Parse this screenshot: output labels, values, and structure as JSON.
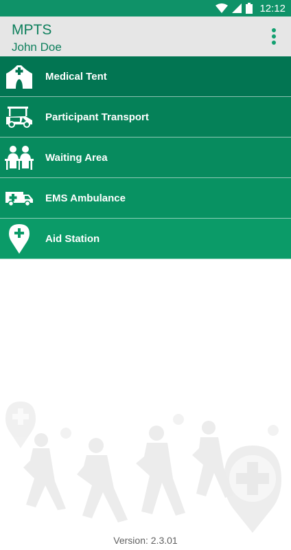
{
  "status": {
    "time": "12:12"
  },
  "app": {
    "title": "MPTS",
    "user": "John Doe"
  },
  "menu": [
    {
      "label": "Medical Tent",
      "color": "#027552"
    },
    {
      "label": "Participant Transport",
      "color": "#058158"
    },
    {
      "label": "Waiting Area",
      "color": "#078b5e"
    },
    {
      "label": "EMS Ambulance",
      "color": "#089262"
    },
    {
      "label": "Aid Station",
      "color": "#0b9b68"
    }
  ],
  "footer": {
    "version": "Version: 2.3.01"
  },
  "colors": {
    "status_bar": "#0f9268",
    "accent": "#0d7f5c",
    "app_bar_bg": "#e6e6e6"
  }
}
